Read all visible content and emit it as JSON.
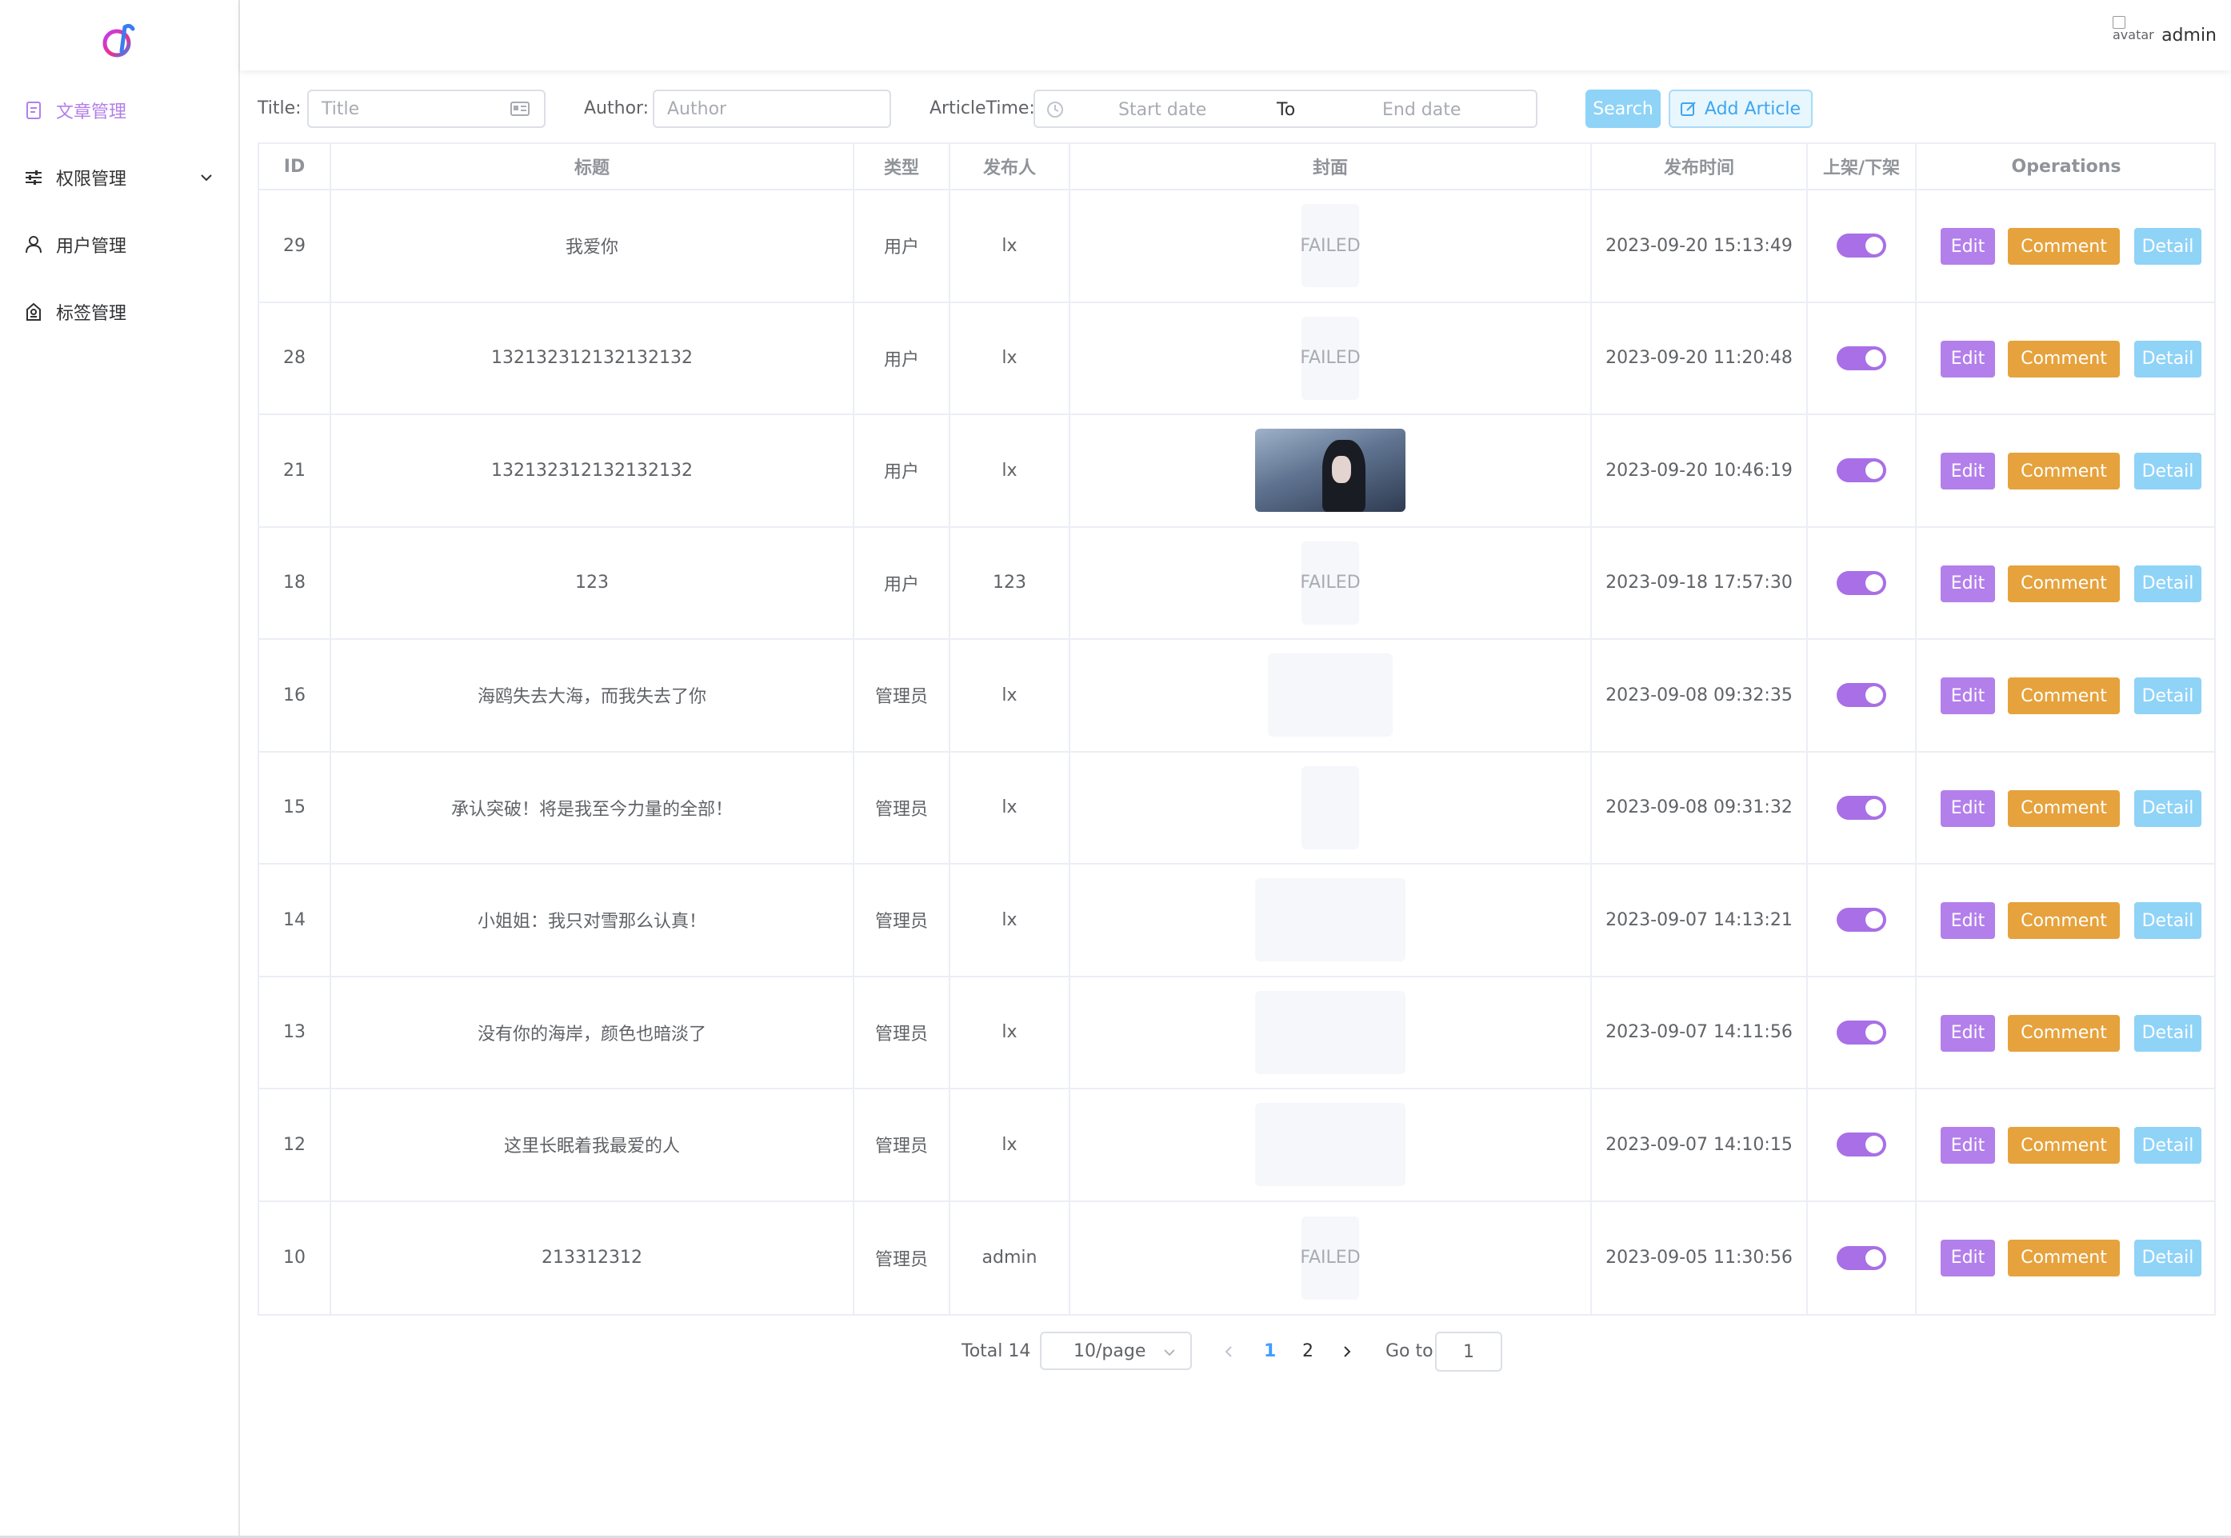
{
  "sidebar": {
    "logo": "app-logo",
    "items": [
      {
        "label": "文章管理",
        "icon": "document-icon",
        "active": true
      },
      {
        "label": "权限管理",
        "icon": "sliders-icon",
        "expandable": true
      },
      {
        "label": "用户管理",
        "icon": "user-icon"
      },
      {
        "label": "标签管理",
        "icon": "tag-icon"
      }
    ]
  },
  "header": {
    "avatar_alt": "avatar",
    "username": "admin"
  },
  "search": {
    "title_label": "Title:",
    "title_placeholder": "Title",
    "author_label": "Author:",
    "author_placeholder": "Author",
    "time_label": "ArticleTime:",
    "start_placeholder": "Start date",
    "range_separator": "To",
    "end_placeholder": "End date",
    "search_button": "Search",
    "add_button": "Add Article"
  },
  "table": {
    "columns": [
      "ID",
      "标题",
      "类型",
      "发布人",
      "封面",
      "发布时间",
      "上架/下架",
      "Operations"
    ],
    "rows": [
      {
        "id": "29",
        "title": "我爱你",
        "type": "用户",
        "author": "lx",
        "cover": "FAILED",
        "time": "2023-09-20 15:13:49",
        "on": true
      },
      {
        "id": "28",
        "title": "132132312132132132",
        "type": "用户",
        "author": "lx",
        "cover": "FAILED",
        "time": "2023-09-20 11:20:48",
        "on": true
      },
      {
        "id": "21",
        "title": "132132312132132132",
        "type": "用户",
        "author": "lx",
        "cover": "photo",
        "time": "2023-09-20 10:46:19",
        "on": true
      },
      {
        "id": "18",
        "title": "123",
        "type": "用户",
        "author": "123",
        "cover": "FAILED",
        "time": "2023-09-18 17:57:30",
        "on": true
      },
      {
        "id": "16",
        "title": "海鸥失去大海，而我失去了你",
        "type": "管理员",
        "author": "lx",
        "cover": "blank-medium",
        "time": "2023-09-08 09:32:35",
        "on": true
      },
      {
        "id": "15",
        "title": "承认突破！将是我至今力量的全部！",
        "type": "管理员",
        "author": "lx",
        "cover": "blank-narrow",
        "time": "2023-09-08 09:31:32",
        "on": true
      },
      {
        "id": "14",
        "title": "小姐姐：我只对雪那么认真！",
        "type": "管理员",
        "author": "lx",
        "cover": "blank-wide",
        "time": "2023-09-07 14:13:21",
        "on": true
      },
      {
        "id": "13",
        "title": "没有你的海岸，颜色也暗淡了",
        "type": "管理员",
        "author": "lx",
        "cover": "blank-wide",
        "time": "2023-09-07 14:11:56",
        "on": true
      },
      {
        "id": "12",
        "title": "这里长眠着我最爱的人",
        "type": "管理员",
        "author": "lx",
        "cover": "blank-wide",
        "time": "2023-09-07 14:10:15",
        "on": true
      },
      {
        "id": "10",
        "title": "213312312",
        "type": "管理员",
        "author": "admin",
        "cover": "FAILED",
        "time": "2023-09-05 11:30:56",
        "on": true
      }
    ],
    "ops": {
      "edit": "Edit",
      "comment": "Comment",
      "detail": "Detail"
    }
  },
  "pagination": {
    "total_text": "Total 14",
    "page_size": "10/page",
    "pages": [
      "1",
      "2"
    ],
    "current_page": "1",
    "goto_label": "Go to",
    "goto_value": "1"
  },
  "colors": {
    "accent_purple": "#b37feb",
    "comment_orange": "#e6a23c",
    "detail_blue": "#8fd3f7",
    "link_blue": "#409eff"
  }
}
